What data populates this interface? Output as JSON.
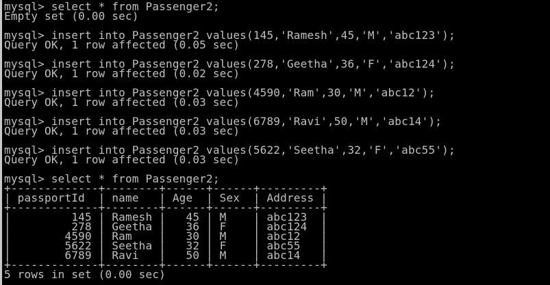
{
  "terminal": {
    "background": "#000000",
    "text_color": "#c0c0c0",
    "lines": [
      "mysql> select * from Passenger2;",
      "Empty set (0.00 sec)",
      "mysql> insert into Passenger2 values(145,'Ramesh',45,'M','abc123');",
      "Query OK, 1 row affected (0.05 sec)",
      "mysql> insert into Passenger2 values(278,'Geetha',36,'F','abc124');",
      "Query OK, 1 row affected (0.02 sec)",
      "mysql> insert into Passenger2 values(4590,'Ram',30,'M','abc12');",
      "Query OK, 1 row affected (0.03 sec)",
      "mysql> insert into Passenger2 values(6789,'Ravi',50,'M','abc14');",
      "Query OK, 1 row affected (0.03 sec)",
      "mysql> insert into Passenger2 values(5622,'Seetha',32,'F','abc55');",
      "Query OK, 1 row affected (0.03 sec)",
      "mysql> select * from Passenger2;",
      "+-------------+--------+------+------+---------+",
      "| passportId  | name   | Age  | Sex  | Address |",
      "+-------------+--------+------+------+---------+",
      "|         145 | Ramesh |   45 | M    | abc123  |",
      "|         278 | Geetha |   36 | F    | abc124  |",
      "|        4590 | Ram    |   30 | M    | abc12   |",
      "|        5622 | Seetha |   32 | F    | abc55   |",
      "|        6789 | Ravi   |   50 | M    | abc14   |",
      "+-------------+--------+------+------+---------+",
      "5 rows in set (0.00 sec)"
    ]
  }
}
